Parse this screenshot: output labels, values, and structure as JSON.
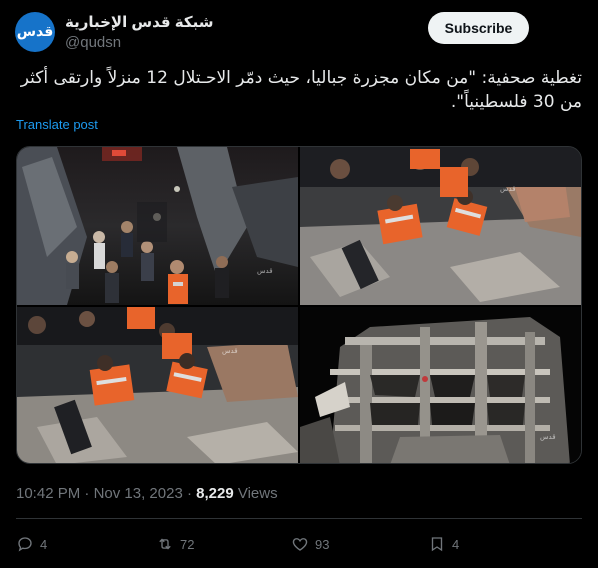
{
  "author": {
    "name": "شبكة قدس الإخبارية",
    "handle": "@qudsn",
    "avatar_text": "قدس",
    "avatar_color": "#1673c9",
    "verified_badge": "none"
  },
  "subscribe_label": "Subscribe",
  "post_text": "تغطية صحفية: \"من مكان مجزرة جباليا، حيث دمّر الاحـتلال 12 منزلاً وارتقى أكثر من 30 فلسطينياً\".",
  "translate_label": "Translate post",
  "media": {
    "watermark": "قدس",
    "images": [
      {
        "name": "crowd-rescue-photo"
      },
      {
        "name": "rescuers-digging-photo"
      },
      {
        "name": "rescuers-rubble-photo"
      },
      {
        "name": "destroyed-building-photo"
      }
    ]
  },
  "meta": {
    "time": "10:42 PM",
    "separator": " · ",
    "date": "Nov 13, 2023",
    "views_count": "8,229",
    "views_label": " Views"
  },
  "actions": {
    "replies": "4",
    "reposts": "72",
    "likes": "93",
    "bookmarks": "4"
  },
  "colors": {
    "background": "#000000",
    "text": "#e7e9ea",
    "secondary": "#71767b",
    "link": "#1d9bf0",
    "border": "#2f3336",
    "rescuer_vest": "#e8642b"
  }
}
